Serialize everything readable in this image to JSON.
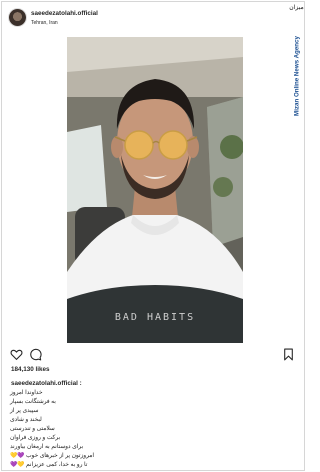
{
  "post": {
    "username": "saeedezatolahi.official",
    "location": "Tehran, Iran",
    "likes": "184,130 likes",
    "caption_user": "saeedezatolahi.official :",
    "caption_lines": [
      "خداوندا امروز",
      "به فرشتگانت بسپار",
      "سپیدی پر از",
      "لبخند و شادی",
      "سلامتی و تندرستی",
      "برکت و روزی فراوان",
      "برای دوستانم به ارمغان بیاورند",
      "امروزتون پر از خبرهای خوب 💜💛",
      "تا رو به خدا، کمی عزیزانم 💛💜"
    ],
    "shirt_text": "BAD HABITS"
  },
  "watermark": {
    "logo_text": "میزان",
    "vertical_text": "Mizan Online News Agency",
    "color": "#1b4f91"
  },
  "icons": {
    "like": "heart-icon",
    "comment": "comment-icon",
    "save": "bookmark-icon"
  }
}
